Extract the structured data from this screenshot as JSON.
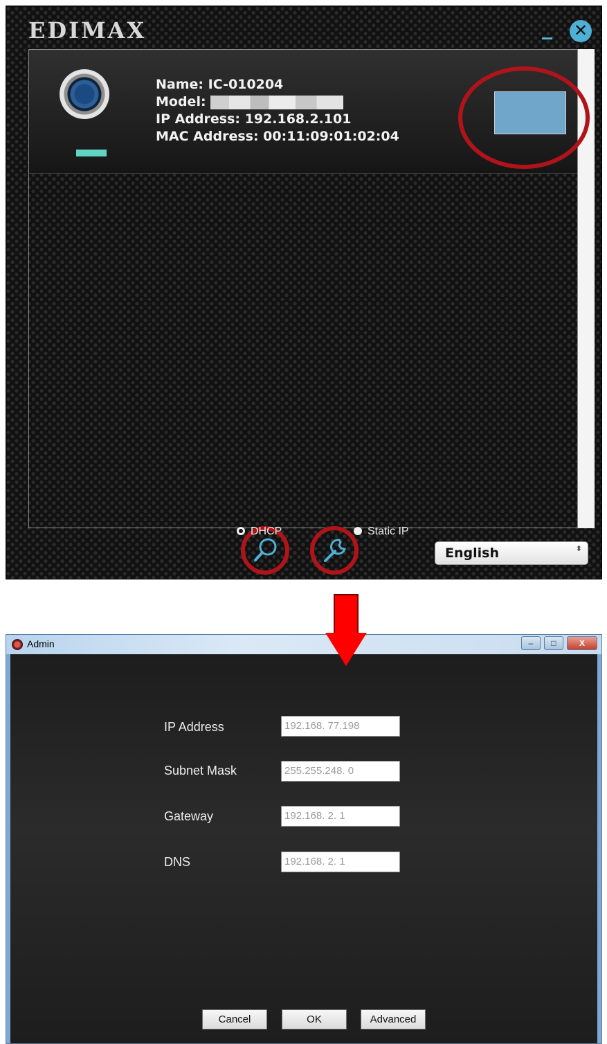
{
  "utility": {
    "logo": "EDIMAX",
    "minimize_glyph": "_",
    "close_glyph": "✕",
    "device": {
      "name": "Name: IC-010204",
      "model_label": "Model:",
      "ip": "IP Address: 192.168.2.101",
      "mac": "MAC Address: 00:11:09:01:02:04"
    },
    "language": {
      "selected": "English",
      "chevron": "⬍"
    },
    "icons": [
      "camera-icon",
      "search-icon",
      "wrench-icon",
      "chevron-updown-icon"
    ]
  },
  "admin": {
    "title": "Admin",
    "titlebar_min": "–",
    "titlebar_max": "□",
    "titlebar_close": "X",
    "radio_dhcp": "DHCP",
    "radio_static": "Static IP",
    "selected_mode": "DHCP",
    "fields": {
      "ip_label": "IP Address",
      "ip_value": "192.168. 77.198",
      "subnet_label": "Subnet Mask",
      "subnet_value": "255.255.248.  0",
      "gateway_label": "Gateway",
      "gateway_value": "192.168.  2.  1",
      "dns_label": "DNS",
      "dns_value": "192.168.  2.  1"
    },
    "buttons": {
      "cancel": "Cancel",
      "ok": "OK",
      "advanced": "Advanced"
    }
  },
  "colors": {
    "highlight": "#b0141a",
    "arrow": "#ff0000",
    "accent_blue": "#4fb0d6",
    "status_green": "#5fd4c2"
  }
}
